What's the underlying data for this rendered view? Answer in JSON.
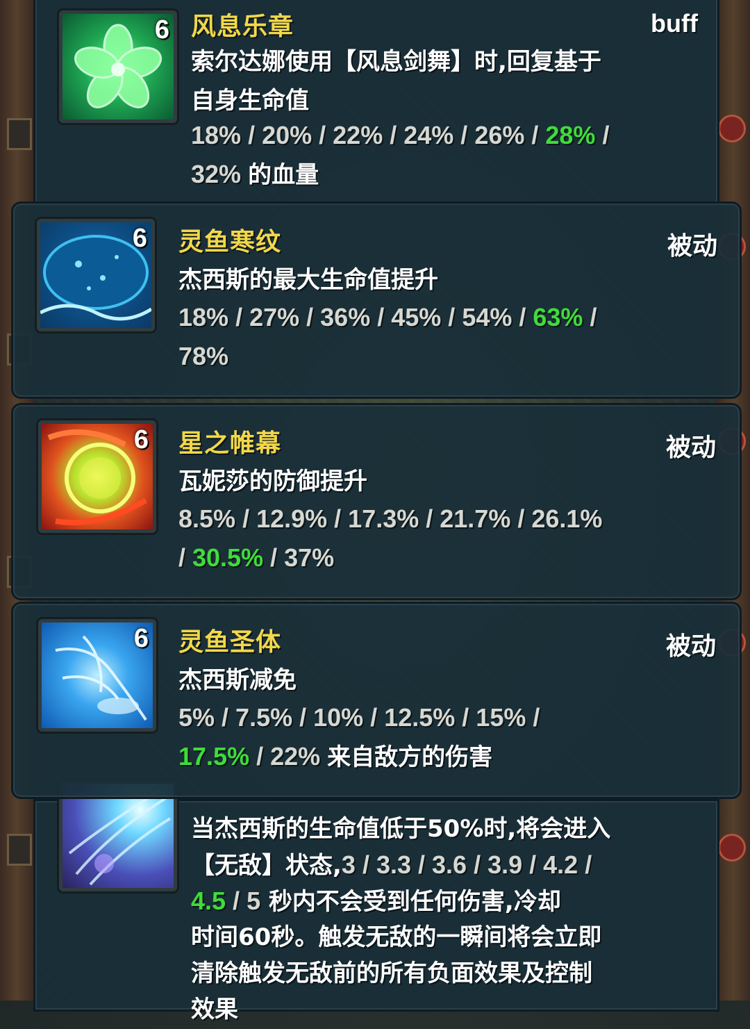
{
  "skills": {
    "wind": {
      "level": "6",
      "name": "风息乐章",
      "type": "buff",
      "desc_line1": "索尔达娜使用【风息剑舞】时,回复基于",
      "desc_line2": "自身生命值",
      "values": [
        "18%",
        "20%",
        "22%",
        "24%",
        "26%",
        "28%",
        "32%"
      ],
      "suffix": "的血量",
      "icon": "green-flower-icon"
    },
    "fish_ripple": {
      "level": "6",
      "name": "灵鱼寒纹",
      "type": "被动",
      "desc": "杰西斯的最大生命值提升",
      "values": [
        "18%",
        "27%",
        "36%",
        "45%",
        "54%",
        "63%",
        "78%"
      ],
      "icon": "water-orb-icon"
    },
    "star_curtain": {
      "level": "6",
      "name": "星之帷幕",
      "type": "被动",
      "desc": "瓦妮莎的防御提升",
      "values": [
        "8.5%",
        "12.9%",
        "17.3%",
        "21.7%",
        "26.1%",
        "30.5%",
        "37%"
      ],
      "icon": "fire-orb-icon"
    },
    "fish_body": {
      "level": "6",
      "name": "灵鱼圣体",
      "type": "被动",
      "desc": "杰西斯减免",
      "values": [
        "5%",
        "7.5%",
        "10%",
        "12.5%",
        "15%",
        "17.5%",
        "22%"
      ],
      "suffix": "来自敌方的伤害",
      "icon": "ice-fish-icon"
    },
    "invincible": {
      "desc_line1": "当杰西斯的生命值低于50%时,将会进入",
      "line2_prefix": "【无敌】状态,",
      "values": [
        "3",
        "3.3",
        "3.6",
        "3.9",
        "4.2",
        "4.5",
        "5"
      ],
      "line3_suffix": "秒内不会受到任何伤害,冷却",
      "desc_line4": "时间60秒。触发无敌的一瞬间将会立即",
      "desc_line5": "清除触发无敌前的所有负面效果及控制",
      "desc_line6": "效果",
      "icon": "light-burst-icon"
    }
  },
  "colors": {
    "skill_name": "#f2d84a",
    "highlight_value": "#3fdc3a",
    "panel_bg": "#192e38"
  }
}
